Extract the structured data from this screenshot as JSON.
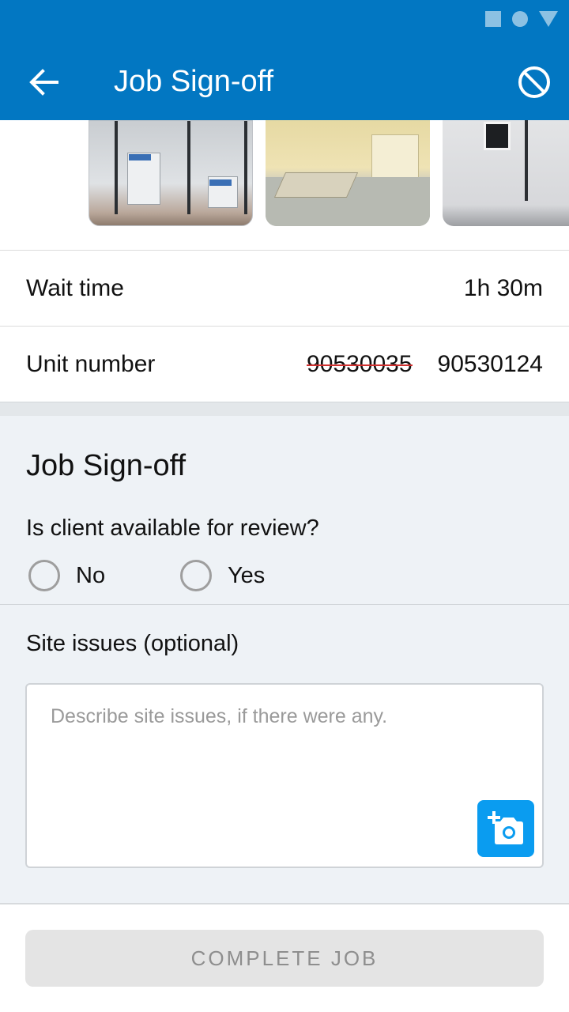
{
  "status_bar": {
    "icons": [
      "square-icon",
      "circle-icon",
      "triangle-icon"
    ]
  },
  "app_bar": {
    "title": "Job Sign-off",
    "back_icon": "arrow-left-icon",
    "cancel_icon": "block-icon",
    "background": "#0277c2"
  },
  "gallery": {
    "photos": [
      {
        "name": "containers-photo",
        "sign": "SIBCAS"
      },
      {
        "name": "interior-room-photo"
      },
      {
        "name": "panel-wall-photo"
      }
    ]
  },
  "details": {
    "wait_time": {
      "label": "Wait time",
      "value": "1h 30m"
    },
    "unit_number": {
      "label": "Unit number",
      "old_value": "90530035",
      "new_value": "90530124"
    }
  },
  "signoff": {
    "title": "Job Sign-off",
    "question": "Is client available for review?",
    "options": [
      {
        "label": "No",
        "selected": false
      },
      {
        "label": "Yes",
        "selected": false
      }
    ],
    "site_issues_label": "Site issues (optional)",
    "site_issues_placeholder": "Describe site issues, if there were any.",
    "site_issues_value": "",
    "camera_icon": "add-photo-icon",
    "accent": "#0a9cf0"
  },
  "footer": {
    "complete_label": "COMPLETE JOB",
    "enabled": false
  }
}
